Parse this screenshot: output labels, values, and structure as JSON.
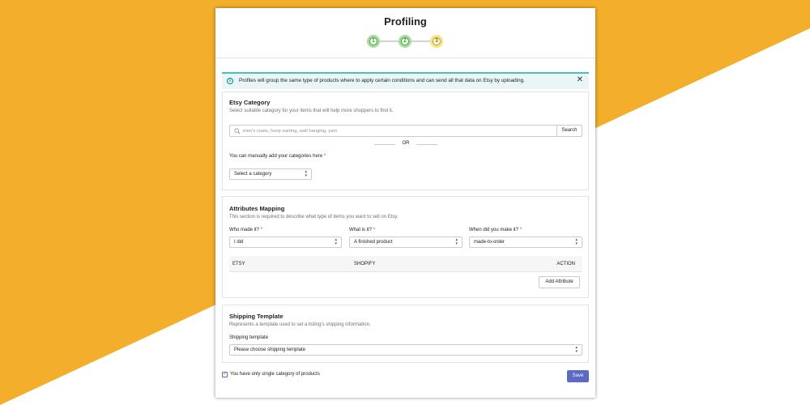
{
  "colors": {
    "background_accent": "#f3ae2b",
    "primary": "#5c6ac4",
    "banner_border": "#47c1bf",
    "step_done": "#43a23a",
    "step_current": "#c89f00",
    "required": "#d82c0d"
  },
  "header": {
    "title": "Profiling",
    "steps": [
      {
        "label": "1",
        "state": "done"
      },
      {
        "label": "2",
        "state": "done"
      },
      {
        "label": "3",
        "state": "current"
      }
    ]
  },
  "banner": {
    "icon": "info-icon",
    "message": "Profiles will group the same type of products where to apply certain conditions and can send all that data on Etsy by uploading.",
    "close_label": "✕"
  },
  "etsy_category": {
    "title": "Etsy Category",
    "subtitle": "Select suitable category for your items that will help more shoppers to find it.",
    "search_placeholder": "men's coats, hoop earring, wall hanging, yarn",
    "search_button": "Search",
    "or_text": "OR",
    "manual_label": "You can manually add your categories here",
    "required_mark": "*",
    "category_select": "Select a category"
  },
  "attributes": {
    "title": "Attributes Mapping",
    "subtitle": "This section is required to describe what type of items you want to sell on Etsy.",
    "who_label": "Who made it?",
    "who_value": "I did",
    "what_label": "What is it?",
    "what_value": "A finished product",
    "when_label": "When did you make it?",
    "when_value": "made-to-order",
    "required_mark": "*",
    "columns": [
      "ETSY",
      "SHOPIFY",
      "ACTION"
    ],
    "add_button": "Add Attribute"
  },
  "shipping": {
    "title": "Shipping Template",
    "subtitle": "Represents a template used to set a listing's shipping information.",
    "field_label": "Shipping template",
    "select_value": "Please choose shipping template"
  },
  "footer": {
    "checkbox_label": "You have only single category of products",
    "checkbox_checked": true,
    "save_button": "Save"
  }
}
